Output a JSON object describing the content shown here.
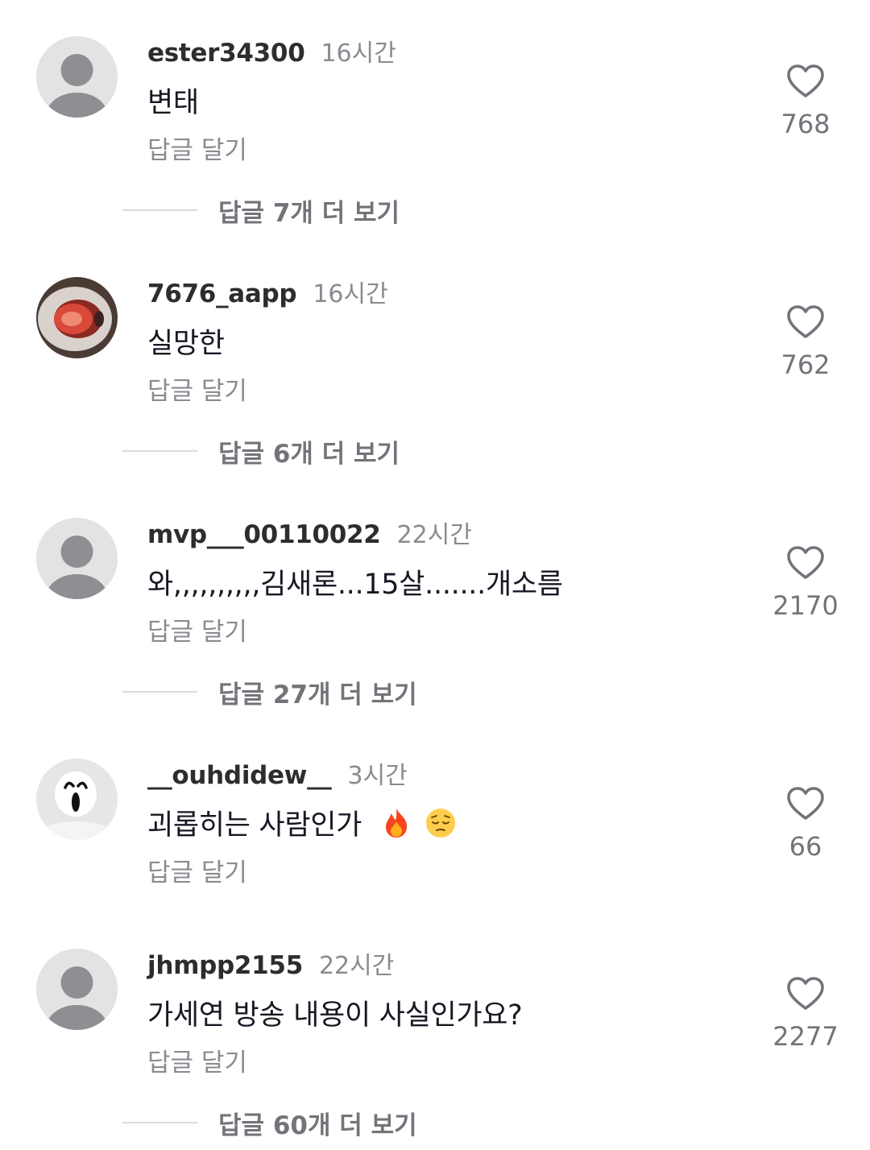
{
  "comments": [
    {
      "username": "ester34300",
      "time": "16시간",
      "text": "변태",
      "reply_label": "답글 달기",
      "likes": "768",
      "view_more": "답글 7개 더 보기",
      "avatar": "default-avatar"
    },
    {
      "username": "7676_aapp",
      "time": "16시간",
      "text": "실망한",
      "reply_label": "답글 달기",
      "likes": "762",
      "view_more": "답글 6개 더 보기",
      "avatar": "strawberry-photo"
    },
    {
      "username": "mvp___00110022",
      "time": "22시간",
      "text": "와,,,,,,,,,,김새론...15살.......개소름",
      "reply_label": "답글 달기",
      "likes": "2170",
      "view_more": "답글 27개 더 보기",
      "avatar": "default-avatar"
    },
    {
      "username": "__ouhdidew__",
      "time": "3시간",
      "text": "괴롭히는 사람인가",
      "emojis": [
        "fire-emoji",
        "pensive-face-emoji"
      ],
      "reply_label": "답글 달기",
      "likes": "66",
      "avatar": "ghost-mask"
    },
    {
      "username": "jhmpp2155",
      "time": "22시간",
      "text": "가세연 방송 내용이 사실인가요?",
      "reply_label": "답글 달기",
      "likes": "2277",
      "view_more": "답글 60개 더 보기",
      "avatar": "default-avatar"
    }
  ],
  "colors": {
    "username": "#2d2d2d",
    "muted": "#8a8b91",
    "heart_outline": "#73747a",
    "divider": "#dcdcdc",
    "avatar_bg": "#e3e3e3",
    "avatar_figure": "#8e8e93"
  }
}
